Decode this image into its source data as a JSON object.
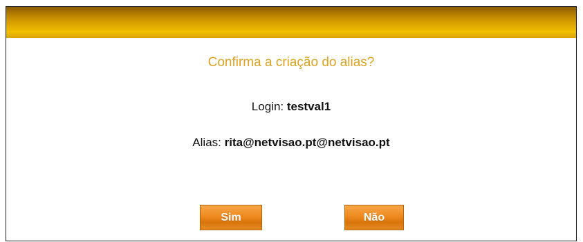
{
  "dialog": {
    "question": "Confirma a criação do alias?",
    "login_label": "Login:",
    "login_value": "testval1",
    "alias_label": "Alias:",
    "alias_value": "rita@netvisao.pt@netvisao.pt",
    "yes_label": "Sim",
    "no_label": "Não"
  },
  "colors": {
    "title_bar": "#d29a00",
    "question_text": "#dea21e",
    "button": "#ee8a1e"
  }
}
